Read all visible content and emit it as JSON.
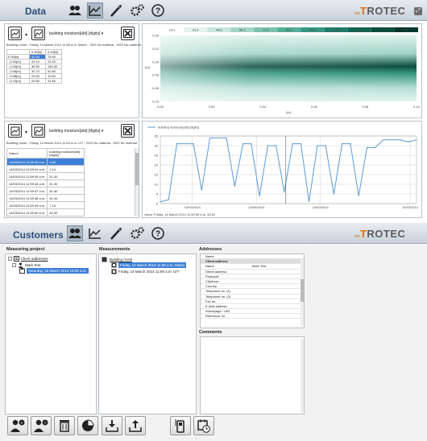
{
  "top": {
    "title": "Data",
    "logo_prefix": "me",
    "logo_t": "T",
    "logo_rest": "ROTEC"
  },
  "bottom": {
    "title": "Customers",
    "logo_prefix": "me",
    "logo_t": "T",
    "logo_rest": "ROTEC"
  },
  "grid_panel": {
    "selector_label": "building moisture[abt] [digits]",
    "info": "Building moist - Friday, 14 March 2014 11:58 a.m. Matrix - SDS No material - SDS No material",
    "col_headers": [
      "",
      "0.00[m]",
      "0.03[m]"
    ],
    "rows": [
      {
        "y": "0.00[m]",
        "a": "40.30",
        "b": "75.60"
      },
      {
        "y": "-0.02[m]",
        "a": "33.10",
        "b": "31.00"
      },
      {
        "y": "-0.04[m]",
        "a": "36.50",
        "b": "150.40"
      },
      {
        "y": "-0.06[m]",
        "a": "30.70",
        "b": "52.80"
      },
      {
        "y": "-0.08[m]",
        "a": "29.00",
        "b": "19.50"
      },
      {
        "y": "-0.10[m]",
        "a": "29.50",
        "b": "31.80"
      }
    ]
  },
  "heatmap": {
    "scale": [
      "16.2",
      "31.6",
      "44.8",
      "58.2",
      "71.6",
      "85.1",
      "98.5",
      "111.9",
      "125.3",
      "138.8",
      "152.2"
    ],
    "y_ticks": [
      "0.00",
      "-0.02",
      "-0.04",
      "-0.06",
      "-0.08",
      "-0.10"
    ],
    "x_ticks": [
      "0.00",
      "0.02",
      "0.04",
      "0.06",
      "0.08",
      "0.10"
    ],
    "y_unit": "[m]",
    "x_unit": "[m]"
  },
  "list_panel": {
    "selector_label": "building moisture[abt] [digits]",
    "info": "Building moist - Friday, 14 March 2014 11:59 a.m. U/T - SDS No material - SDS No material",
    "col_date": "Datum",
    "col_value": "building moisture[abt] [digits]",
    "rows": [
      {
        "d": "14/03/2014 11:59:00 a.m.",
        "v": "5.60"
      },
      {
        "d": "14/03/2014 11:59:44 a.m.",
        "v": "2.10"
      },
      {
        "d": "14/03/2014 11:59:45 a.m.",
        "v": "31.40"
      },
      {
        "d": "14/03/2014 11:59:46 a.m.",
        "v": "31.30"
      },
      {
        "d": "14/03/2014 11:59:47 a.m.",
        "v": "31.40"
      },
      {
        "d": "14/03/2014 11:59:48 a.m.",
        "v": "31.40"
      },
      {
        "d": "14/03/2014 11:59:49 a.m.",
        "v": "7.10"
      },
      {
        "d": "14/03/2014 11:59:50 a.m.",
        "v": "34.00"
      }
    ]
  },
  "chart_data": {
    "type": "line",
    "series": [
      {
        "name": "building moisture[abt] [digits]",
        "values": [
          1,
          2,
          31,
          31,
          31,
          7,
          34,
          34,
          34,
          9,
          31,
          31,
          4,
          30,
          30,
          6,
          31,
          31,
          1,
          30,
          30,
          5,
          31,
          31,
          4,
          29,
          29,
          33,
          33,
          33,
          32,
          33
        ]
      }
    ],
    "ylim": [
      0,
      35
    ],
    "y_ticks": [
      "0",
      "5",
      "10",
      "15",
      "20",
      "25",
      "30",
      "35"
    ],
    "x_ticks": [
      "14/03/2014",
      "14/03/2014",
      "14/03/2014",
      "14/03/2014"
    ],
    "grid": true,
    "legend": "top-left",
    "status": "Value: Friday, 14 March 2014 11:59:59 a.m. 28.62"
  },
  "customers": {
    "project_title": "Measuring project",
    "client_addresses": "Client addresses",
    "client_name": "Mark Test",
    "project_entry": "Saturday, 15 March 2014 13:03 a.m.",
    "measurements_title": "Measurements",
    "building": "Building moist",
    "m1": "Friday, 14 March 2014 11:58 a.m. Matrix",
    "m2": "Friday, 14 March 2014 11:59 a.m. U/T",
    "addresses_title": "Addresses",
    "addr_col": "Name",
    "addr_group": "Client address",
    "addr_fields": [
      {
        "label": "Name",
        "value": "Mark Test"
      },
      {
        "label": "Street address",
        "value": ""
      },
      {
        "label": "Postcode",
        "value": ""
      },
      {
        "label": "City/town",
        "value": ""
      },
      {
        "label": "Country",
        "value": ""
      },
      {
        "label": "Telephone no. (1)",
        "value": ""
      },
      {
        "label": "Telephone no. (2)",
        "value": ""
      },
      {
        "label": "Fax no.",
        "value": ""
      },
      {
        "label": "E-Mail address",
        "value": ""
      },
      {
        "label": "Homepage / URL",
        "value": ""
      },
      {
        "label": "Reference no.",
        "value": ""
      }
    ],
    "comments_title": "Comments"
  }
}
